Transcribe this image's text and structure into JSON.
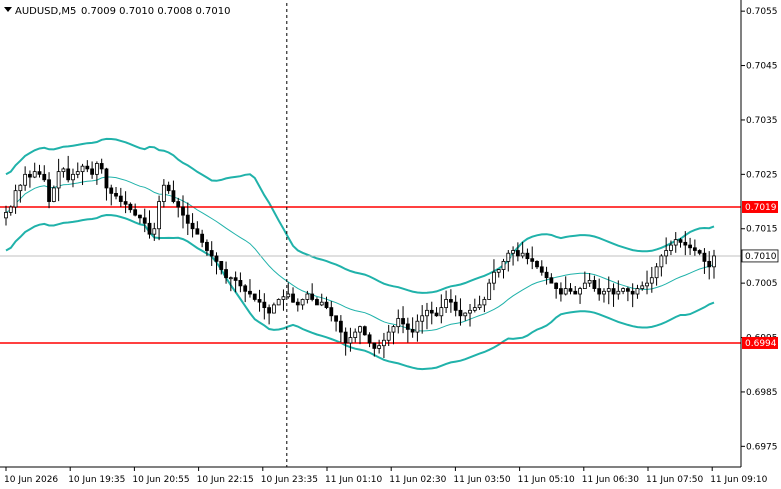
{
  "header": {
    "symbol_line": "AUDUSD,M5",
    "ohlc": "0.7009 0.7010 0.7008 0.7010"
  },
  "colors": {
    "background": "#ffffff",
    "axis": "#000000",
    "candle": "#000000",
    "bollinger": "#20b2aa",
    "level": "#ff0000",
    "price_tag": "#ffffff"
  },
  "chart_data": {
    "type": "line",
    "title": "AUDUSD,M5",
    "ylim": [
      0.69712,
      0.70565
    ],
    "grid": false,
    "y_ticks": [
      "0.7055",
      "0.7045",
      "0.7035",
      "0.7025",
      "0.7015",
      "0.7005",
      "0.6995",
      "0.6985",
      "0.6975"
    ],
    "x_ticks": [
      "10 Jun 2026",
      "10 Jun 19:35",
      "10 Jun 20:55",
      "10 Jun 22:15",
      "10 Jun 23:35",
      "11 Jun 01:10",
      "11 Jun 02:30",
      "11 Jun 03:50",
      "11 Jun 05:10",
      "11 Jun 06:30",
      "11 Jun 07:50",
      "11 Jun 09:10"
    ],
    "period_separator_at": "10 Jun 23:35",
    "levels": [
      {
        "value": "0.7019",
        "color": "#ff0000"
      },
      {
        "value": "0.6994",
        "color": "#ff0000"
      }
    ],
    "current_price": {
      "value": "0.7010"
    },
    "indicators": [
      "Bollinger upper",
      "Bollinger middle",
      "Bollinger lower"
    ],
    "close_series": [
      0.7018,
      0.7019,
      0.7022,
      0.7023,
      0.7025,
      0.70245,
      0.70255,
      0.7025,
      0.7024,
      0.702,
      0.70225,
      0.70255,
      0.7026,
      0.7024,
      0.7025,
      0.70255,
      0.70265,
      0.7026,
      0.7025,
      0.7027,
      0.7026,
      0.70225,
      0.70215,
      0.7021,
      0.702,
      0.70195,
      0.70185,
      0.70175,
      0.7017,
      0.7016,
      0.7014,
      0.7015,
      0.702,
      0.7023,
      0.7022,
      0.702,
      0.7019,
      0.70175,
      0.7016,
      0.7015,
      0.7014,
      0.70125,
      0.7011,
      0.701,
      0.7009,
      0.70075,
      0.7006,
      0.7006,
      0.70055,
      0.70045,
      0.70035,
      0.7003,
      0.7002,
      0.70015,
      0.70005,
      0.69995,
      0.7001,
      0.7002,
      0.70025,
      0.7003,
      0.70015,
      0.7001,
      0.7002,
      0.7003,
      0.7002,
      0.7001,
      0.70015,
      0.70005,
      0.6999,
      0.6998,
      0.6996,
      0.6994,
      0.6995,
      0.6996,
      0.6997,
      0.69955,
      0.6994,
      0.6993,
      0.69935,
      0.69945,
      0.6996,
      0.6997,
      0.69985,
      0.69975,
      0.69965,
      0.6996,
      0.6998,
      0.6999,
      0.7,
      0.69995,
      0.6999,
      0.70005,
      0.7002,
      0.70015,
      0.7,
      0.6999,
      0.69995,
      0.7,
      0.70005,
      0.7001,
      0.7002,
      0.7005,
      0.7007,
      0.70075,
      0.7009,
      0.70105,
      0.7011,
      0.701,
      0.70105,
      0.70095,
      0.7009,
      0.7008,
      0.7007,
      0.7006,
      0.7005,
      0.7004,
      0.7003,
      0.7004,
      0.70035,
      0.7003,
      0.7004,
      0.7005,
      0.70055,
      0.7004,
      0.7003,
      0.70035,
      0.7004,
      0.7003,
      0.70035,
      0.7004,
      0.70035,
      0.7003,
      0.7004,
      0.70045,
      0.7005,
      0.7006,
      0.7008,
      0.701,
      0.7011,
      0.7012,
      0.7013,
      0.70125,
      0.7012,
      0.70115,
      0.7011,
      0.70105,
      0.7009,
      0.7008,
      0.701
    ]
  }
}
